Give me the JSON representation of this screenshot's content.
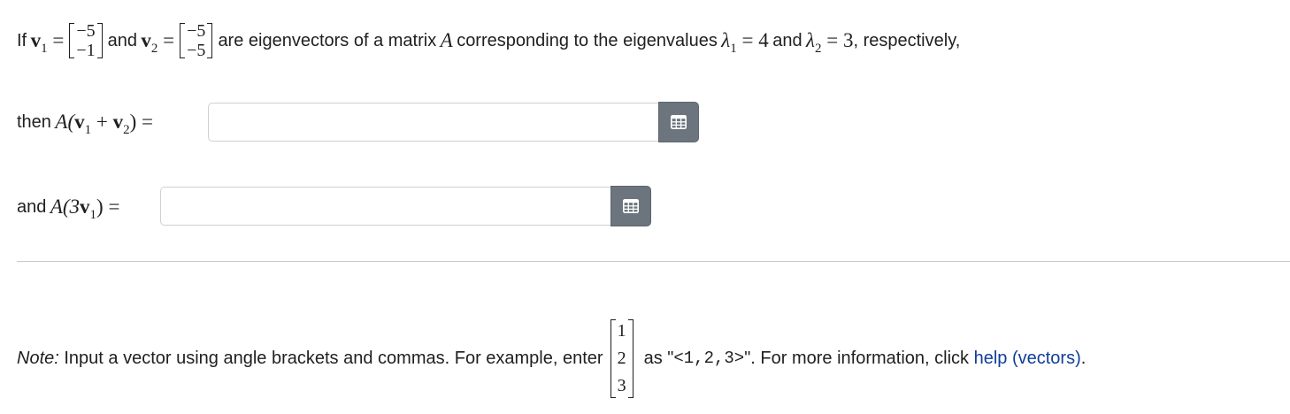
{
  "question": {
    "if_word": "If",
    "and_word": "and",
    "v": "v",
    "sub1": "1",
    "sub2": "2",
    "eq": "=",
    "v1_entries": [
      "−5",
      "−1"
    ],
    "v2_entries": [
      "−5",
      "−5"
    ],
    "middle_text": "are eigenvectors of a matrix",
    "matrix_name": "A",
    "corr_text": "corresponding to the eigenvalues",
    "lambda": "λ",
    "lambda1_value": "4",
    "lambda2_value": "3",
    "respectively_text": ", respectively,"
  },
  "part1": {
    "then_word": "then",
    "expr_prefix": "A(",
    "plus": " + ",
    "expr_suffix": ")",
    "input_value": ""
  },
  "part2": {
    "and_word": "and",
    "expr_prefix": "A(3",
    "expr_suffix": ")",
    "input_value": ""
  },
  "note": {
    "label": "Note:",
    "text": "Input a vector using angle brackets and commas. For example, enter",
    "example_entries": [
      "1",
      "2",
      "3"
    ],
    "as_text": "as \"",
    "example_code": "<1,2,3>",
    "after_code": "\". For more information, click",
    "help_link": "help (vectors)",
    "period": "."
  },
  "icons": {
    "grid_button_icon": "matrix-grid-icon"
  }
}
